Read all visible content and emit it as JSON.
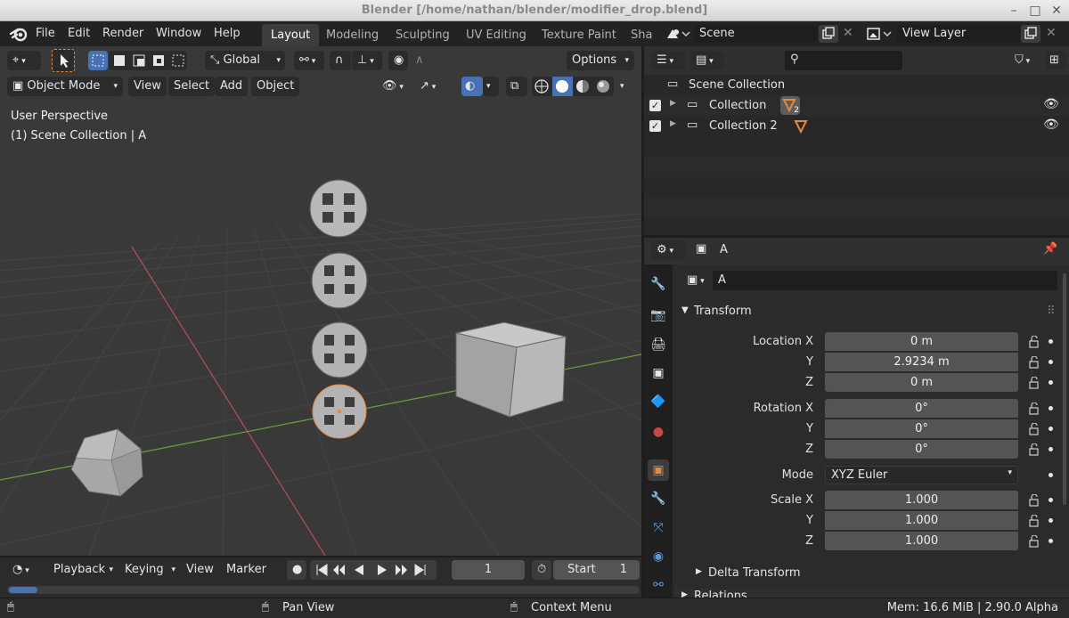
{
  "window": {
    "title": "Blender [/home/nathan/blender/modifier_drop.blend]"
  },
  "menu": {
    "items": [
      "File",
      "Edit",
      "Render",
      "Window",
      "Help"
    ]
  },
  "workspaces": {
    "tabs": [
      "Layout",
      "Modeling",
      "Sculpting",
      "UV Editing",
      "Texture Paint",
      "Sha"
    ],
    "active": "Layout"
  },
  "scene": {
    "name": "Scene",
    "view_layer": "View Layer"
  },
  "viewport": {
    "transform_orientation": "Global",
    "options_label": "Options",
    "mode": "Object Mode",
    "menus": [
      "View",
      "Select",
      "Add",
      "Object"
    ],
    "info_line1": "User Perspective",
    "info_line2": "(1) Scene Collection | A"
  },
  "outliner": {
    "root": "Scene Collection",
    "rows": [
      {
        "label": "Collection",
        "badge": "2"
      },
      {
        "label": "Collection 2",
        "badge": ""
      }
    ]
  },
  "properties": {
    "object_name": "A",
    "datablock_name": "A",
    "panel_title": "Transform",
    "location": {
      "label": "Location X",
      "x": "0 m",
      "y": "2.9234 m",
      "z": "0 m"
    },
    "rotation": {
      "label": "Rotation X",
      "x": "0°",
      "y": "0°",
      "z": "0°"
    },
    "mode": {
      "label": "Mode",
      "value": "XYZ Euler"
    },
    "scale": {
      "label": "Scale X",
      "x": "1.000",
      "y": "1.000",
      "z": "1.000"
    },
    "axis_y": "Y",
    "axis_z": "Z",
    "delta_transform": "Delta Transform",
    "relations": "Relations"
  },
  "timeline": {
    "menus": [
      "Playback",
      "Keying",
      "View",
      "Marker"
    ],
    "current_frame": "1",
    "start_label": "Start",
    "start_value": "1"
  },
  "status": {
    "pan_view": "Pan View",
    "context_menu": "Context Menu",
    "memory": "Mem: 16.6 MiB | 2.90.0 Alpha"
  },
  "colors": {
    "accent_blue": "#4772b3",
    "active_orange": "#e68a3a",
    "x_axis": "#b34b57",
    "y_axis": "#6d9a3a"
  }
}
